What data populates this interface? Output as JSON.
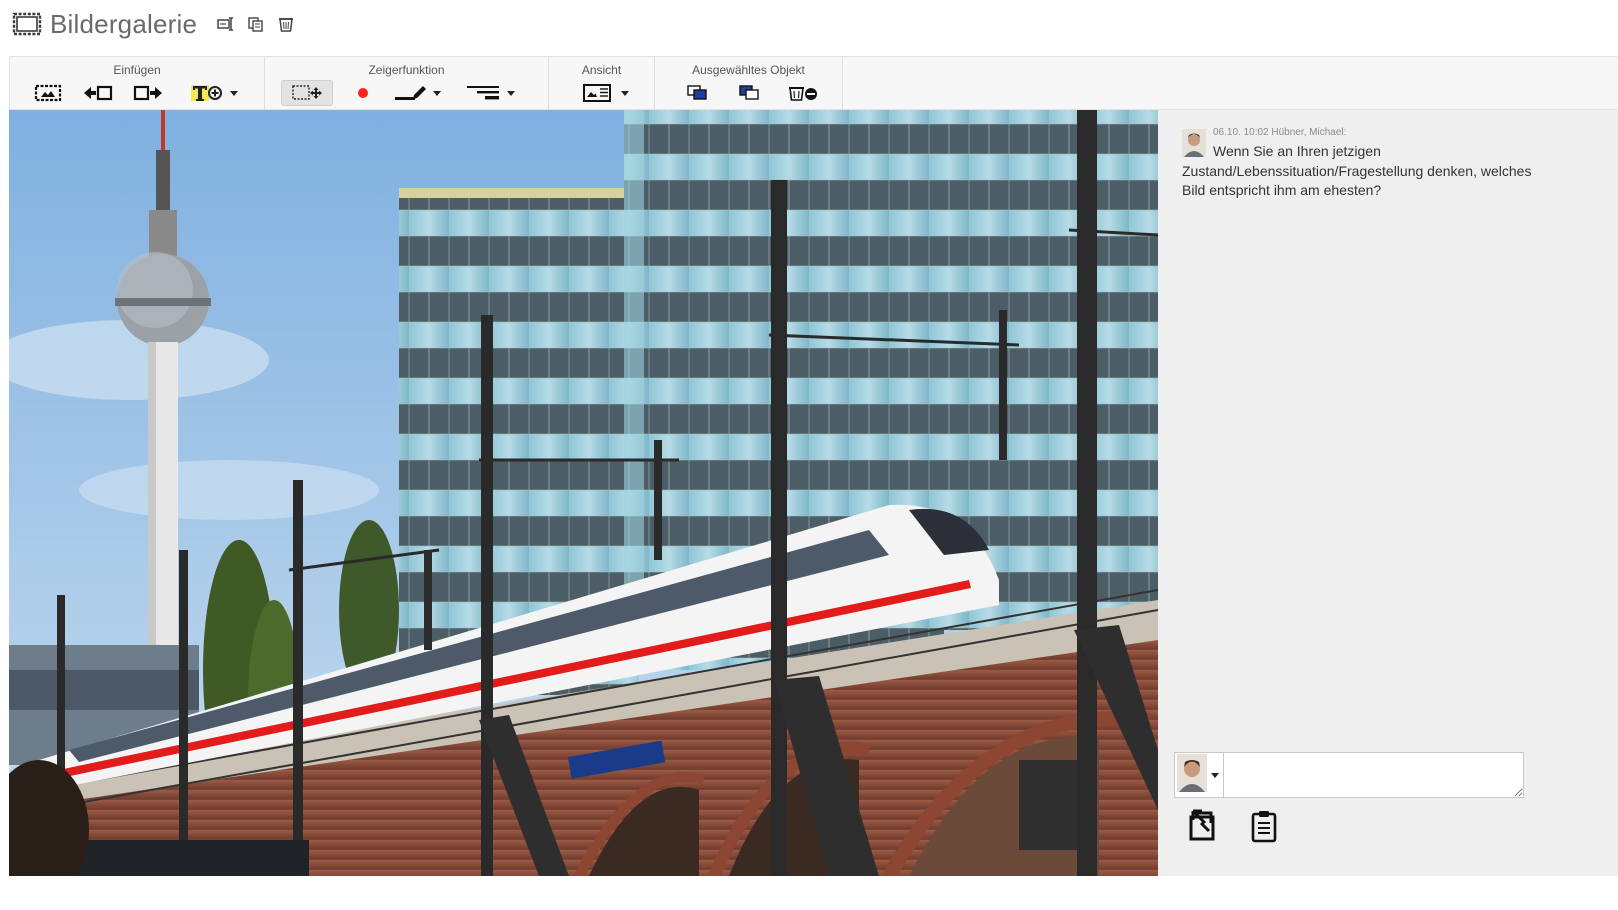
{
  "app": {
    "title": "Bildergalerie"
  },
  "ribbon": {
    "groups": [
      {
        "label": "Einfügen"
      },
      {
        "label": "Zeigerfunktion"
      },
      {
        "label": "Ansicht"
      },
      {
        "label": "Ausgewähltes Objekt"
      }
    ]
  },
  "comment": {
    "meta": "06.10. 10:02 Hübner, Michael:",
    "text": "Wenn Sie an Ihren jetzigen Zustand/Lebenssituation/Fragestellung denken, welches Bild entspricht ihm am ehesten?"
  },
  "composer": {
    "placeholder": ""
  },
  "colors": {
    "accent_red": "#ff2020",
    "highlight_yellow": "#f3e85a",
    "panel_bg": "#efefef"
  }
}
